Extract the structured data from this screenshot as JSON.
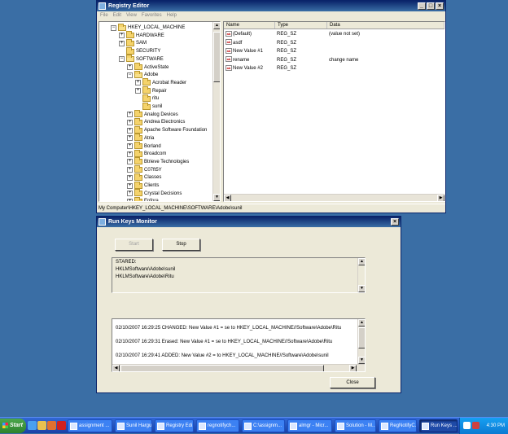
{
  "registry_editor": {
    "title": "Registry Editor",
    "menu": [
      "File",
      "Edit",
      "View",
      "Favorites",
      "Help"
    ],
    "tree": [
      {
        "label": "HKEY_LOCAL_MACHINE",
        "expander": "−",
        "open": true
      },
      {
        "label": "HARDWARE",
        "expander": "+"
      },
      {
        "label": "SAM",
        "expander": "+"
      },
      {
        "label": "SECURITY",
        "expander": ""
      },
      {
        "label": "SOFTWARE",
        "expander": "−",
        "open": true
      },
      {
        "label": "ActiveState",
        "expander": "+"
      },
      {
        "label": "Adobe",
        "expander": "−",
        "open": true
      },
      {
        "label": "Acrobat Reader",
        "expander": "+"
      },
      {
        "label": "Repair",
        "expander": "+"
      },
      {
        "label": "ritu",
        "expander": ""
      },
      {
        "label": "sunil",
        "expander": ""
      },
      {
        "label": "Analog Devices",
        "expander": "+"
      },
      {
        "label": "Andrea Electronics",
        "expander": "+"
      },
      {
        "label": "Apache Software Foundation",
        "expander": "+"
      },
      {
        "label": "Atria",
        "expander": "+"
      },
      {
        "label": "Borland",
        "expander": "+"
      },
      {
        "label": "Broadcom",
        "expander": "+"
      },
      {
        "label": "Btrieve Technologies",
        "expander": "+"
      },
      {
        "label": "C07ft5Y",
        "expander": "+"
      },
      {
        "label": "Classes",
        "expander": "+"
      },
      {
        "label": "Clients",
        "expander": "+"
      },
      {
        "label": "Crystal Decisions",
        "expander": "+"
      },
      {
        "label": "Enfora",
        "expander": "+"
      }
    ],
    "columns": [
      "Name",
      "Type",
      "Data"
    ],
    "values": [
      {
        "name": "(Default)",
        "type": "REG_SZ",
        "data": "(value not set)"
      },
      {
        "name": "asdf",
        "type": "REG_SZ",
        "data": ""
      },
      {
        "name": "New Value #1",
        "type": "REG_SZ",
        "data": ""
      },
      {
        "name": "rename",
        "type": "REG_SZ",
        "data": "change name"
      },
      {
        "name": "New Value #2",
        "type": "REG_SZ",
        "data": ""
      }
    ],
    "status_path": "My Computer\\HKEY_LOCAL_MACHINE\\SOFTWARE\\Adobe\\sunil"
  },
  "run_keys_monitor": {
    "title": "Run Keys Monitor",
    "start_label": "Start",
    "stop_label": "Stop",
    "status_lines": [
      "STARED:",
      "HKLMSoftware\\Adobe\\sunil",
      "HKLMSoftware\\Adobe\\Ritu"
    ],
    "log_lines": [
      "02/10/2007 16:29:25 CHANGED: New Value #1 = se to HKEY_LOCAL_MACHINE//Software\\Adobe\\Ritu",
      "02/10/2007 16:29:31 Erased: New Value #1 = se to HKEY_LOCAL_MACHINE//Software\\Adobe\\Ritu",
      "02/10/2007 16:29:41 ADDED: New Value #2 = to HKEY_LOCAL_MACHINE//Software\\Adobe\\sunil"
    ],
    "close_label": "Close"
  },
  "taskbar": {
    "start_label": "Start",
    "tasks": [
      {
        "label": "assignment ...",
        "active": false
      },
      {
        "label": "Sunil Hargu...",
        "active": false
      },
      {
        "label": "Registry Edi...",
        "active": false
      },
      {
        "label": "regnotifych...",
        "active": false
      },
      {
        "label": "C:\\assignm...",
        "active": false
      },
      {
        "label": "almgr - Micr...",
        "active": false
      },
      {
        "label": "Solution - M...",
        "active": false
      },
      {
        "label": "RegNotifyC...",
        "active": false
      },
      {
        "label": "Run Keys ...",
        "active": true
      }
    ],
    "clock": "4:30 PM"
  }
}
